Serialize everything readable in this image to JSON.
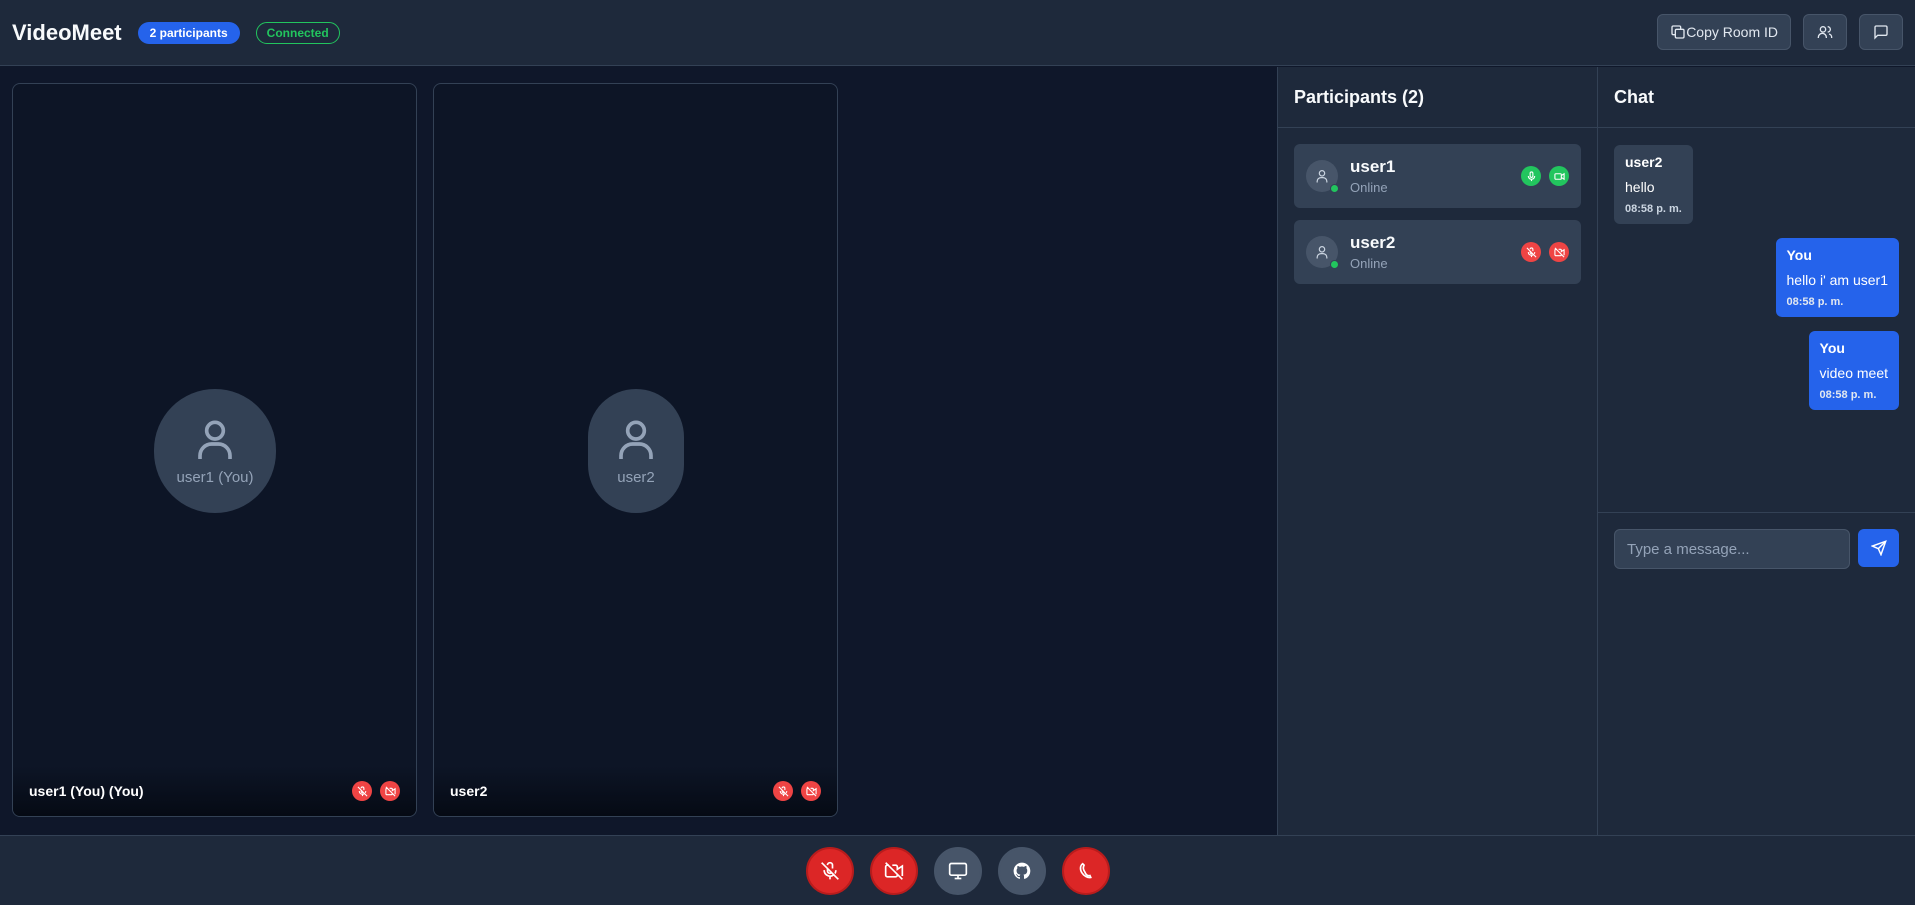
{
  "header": {
    "title": "VideoMeet",
    "participants_badge": "2 participants",
    "status_badge": "Connected",
    "copy_room_label": "Copy Room ID"
  },
  "tiles": [
    {
      "avatar_label": "user1 (You)",
      "name": "user1 (You) (You)"
    },
    {
      "avatar_label": "user2",
      "name": "user2"
    }
  ],
  "participants": {
    "heading": "Participants (2)",
    "items": [
      {
        "name": "user1",
        "status": "Online",
        "mic": "on",
        "camera": "on"
      },
      {
        "name": "user2",
        "status": "Online",
        "mic": "off",
        "camera": "off"
      }
    ]
  },
  "chat": {
    "heading": "Chat",
    "messages": [
      {
        "sender": "user2",
        "text": "hello",
        "time": "08:58 p. m.",
        "own": false
      },
      {
        "sender": "You",
        "text": "hello i' am user1",
        "time": "08:58 p. m.",
        "own": true
      },
      {
        "sender": "You",
        "text": "video meet",
        "time": "08:58 p. m.",
        "own": true
      }
    ],
    "input_placeholder": "Type a message..."
  },
  "colors": {
    "accent": "#2563eb",
    "success": "#22c55e",
    "danger": "#ef4444",
    "background": "#0f172a",
    "panel": "#1e293b"
  },
  "icons": {
    "copy": "copy-icon",
    "participants": "users-icon",
    "chat": "message-square-icon",
    "mic_off": "mic-off-icon",
    "video_off": "video-off-icon",
    "screen": "monitor-icon",
    "github": "github-icon",
    "hangup": "phone-off-icon",
    "send": "send-icon"
  }
}
